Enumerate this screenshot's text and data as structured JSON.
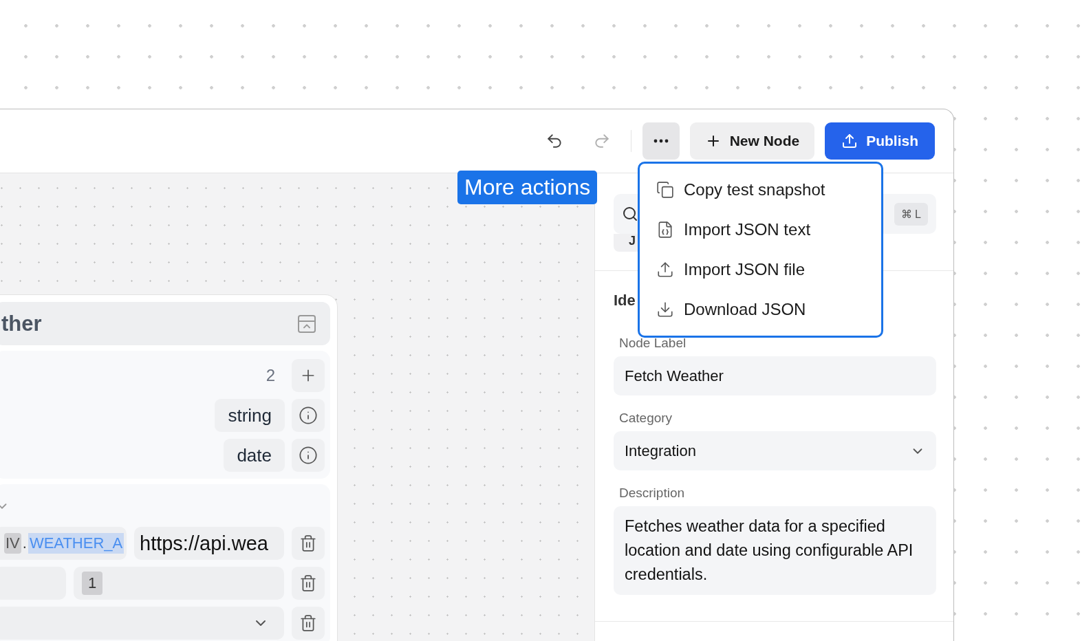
{
  "toolbar": {
    "history": [
      {
        "kind": "undo",
        "disabled": false
      },
      {
        "kind": "redo",
        "disabled": true
      }
    ],
    "more_button": {
      "selected": true
    },
    "new_node": "New Node",
    "publish": "Publish"
  },
  "tooltip": "More actions",
  "menu": {
    "items": [
      {
        "kind": "copy",
        "label": "Copy test snapshot"
      },
      {
        "kind": "file-json",
        "label": "Import JSON text"
      },
      {
        "kind": "upload",
        "label": "Import JSON file"
      },
      {
        "kind": "download",
        "label": "Download JSON"
      }
    ]
  },
  "node": {
    "title": "ther",
    "input_count": "2",
    "params": [
      {
        "type": "string"
      },
      {
        "type": "date"
      }
    ],
    "headers": [
      {
        "kind": "env",
        "prefix": "IV",
        "separator": ".",
        "variable": "WEATHER_A",
        "value": "https://api.wea"
      },
      {
        "kind": "number",
        "value": "1"
      },
      {
        "kind": "select"
      }
    ]
  },
  "panel": {
    "search": {
      "shortcut": "⌘ L"
    },
    "chip": "J",
    "section_title": "Ide",
    "fields": [
      {
        "kind": "text",
        "label": "Node Label",
        "value": "Fetch Weather"
      },
      {
        "kind": "select",
        "label": "Category",
        "value": "Integration"
      },
      {
        "kind": "textarea",
        "label": "Description",
        "value": "Fetches weather data for a specified location and date using configurable API credentials."
      }
    ]
  }
}
